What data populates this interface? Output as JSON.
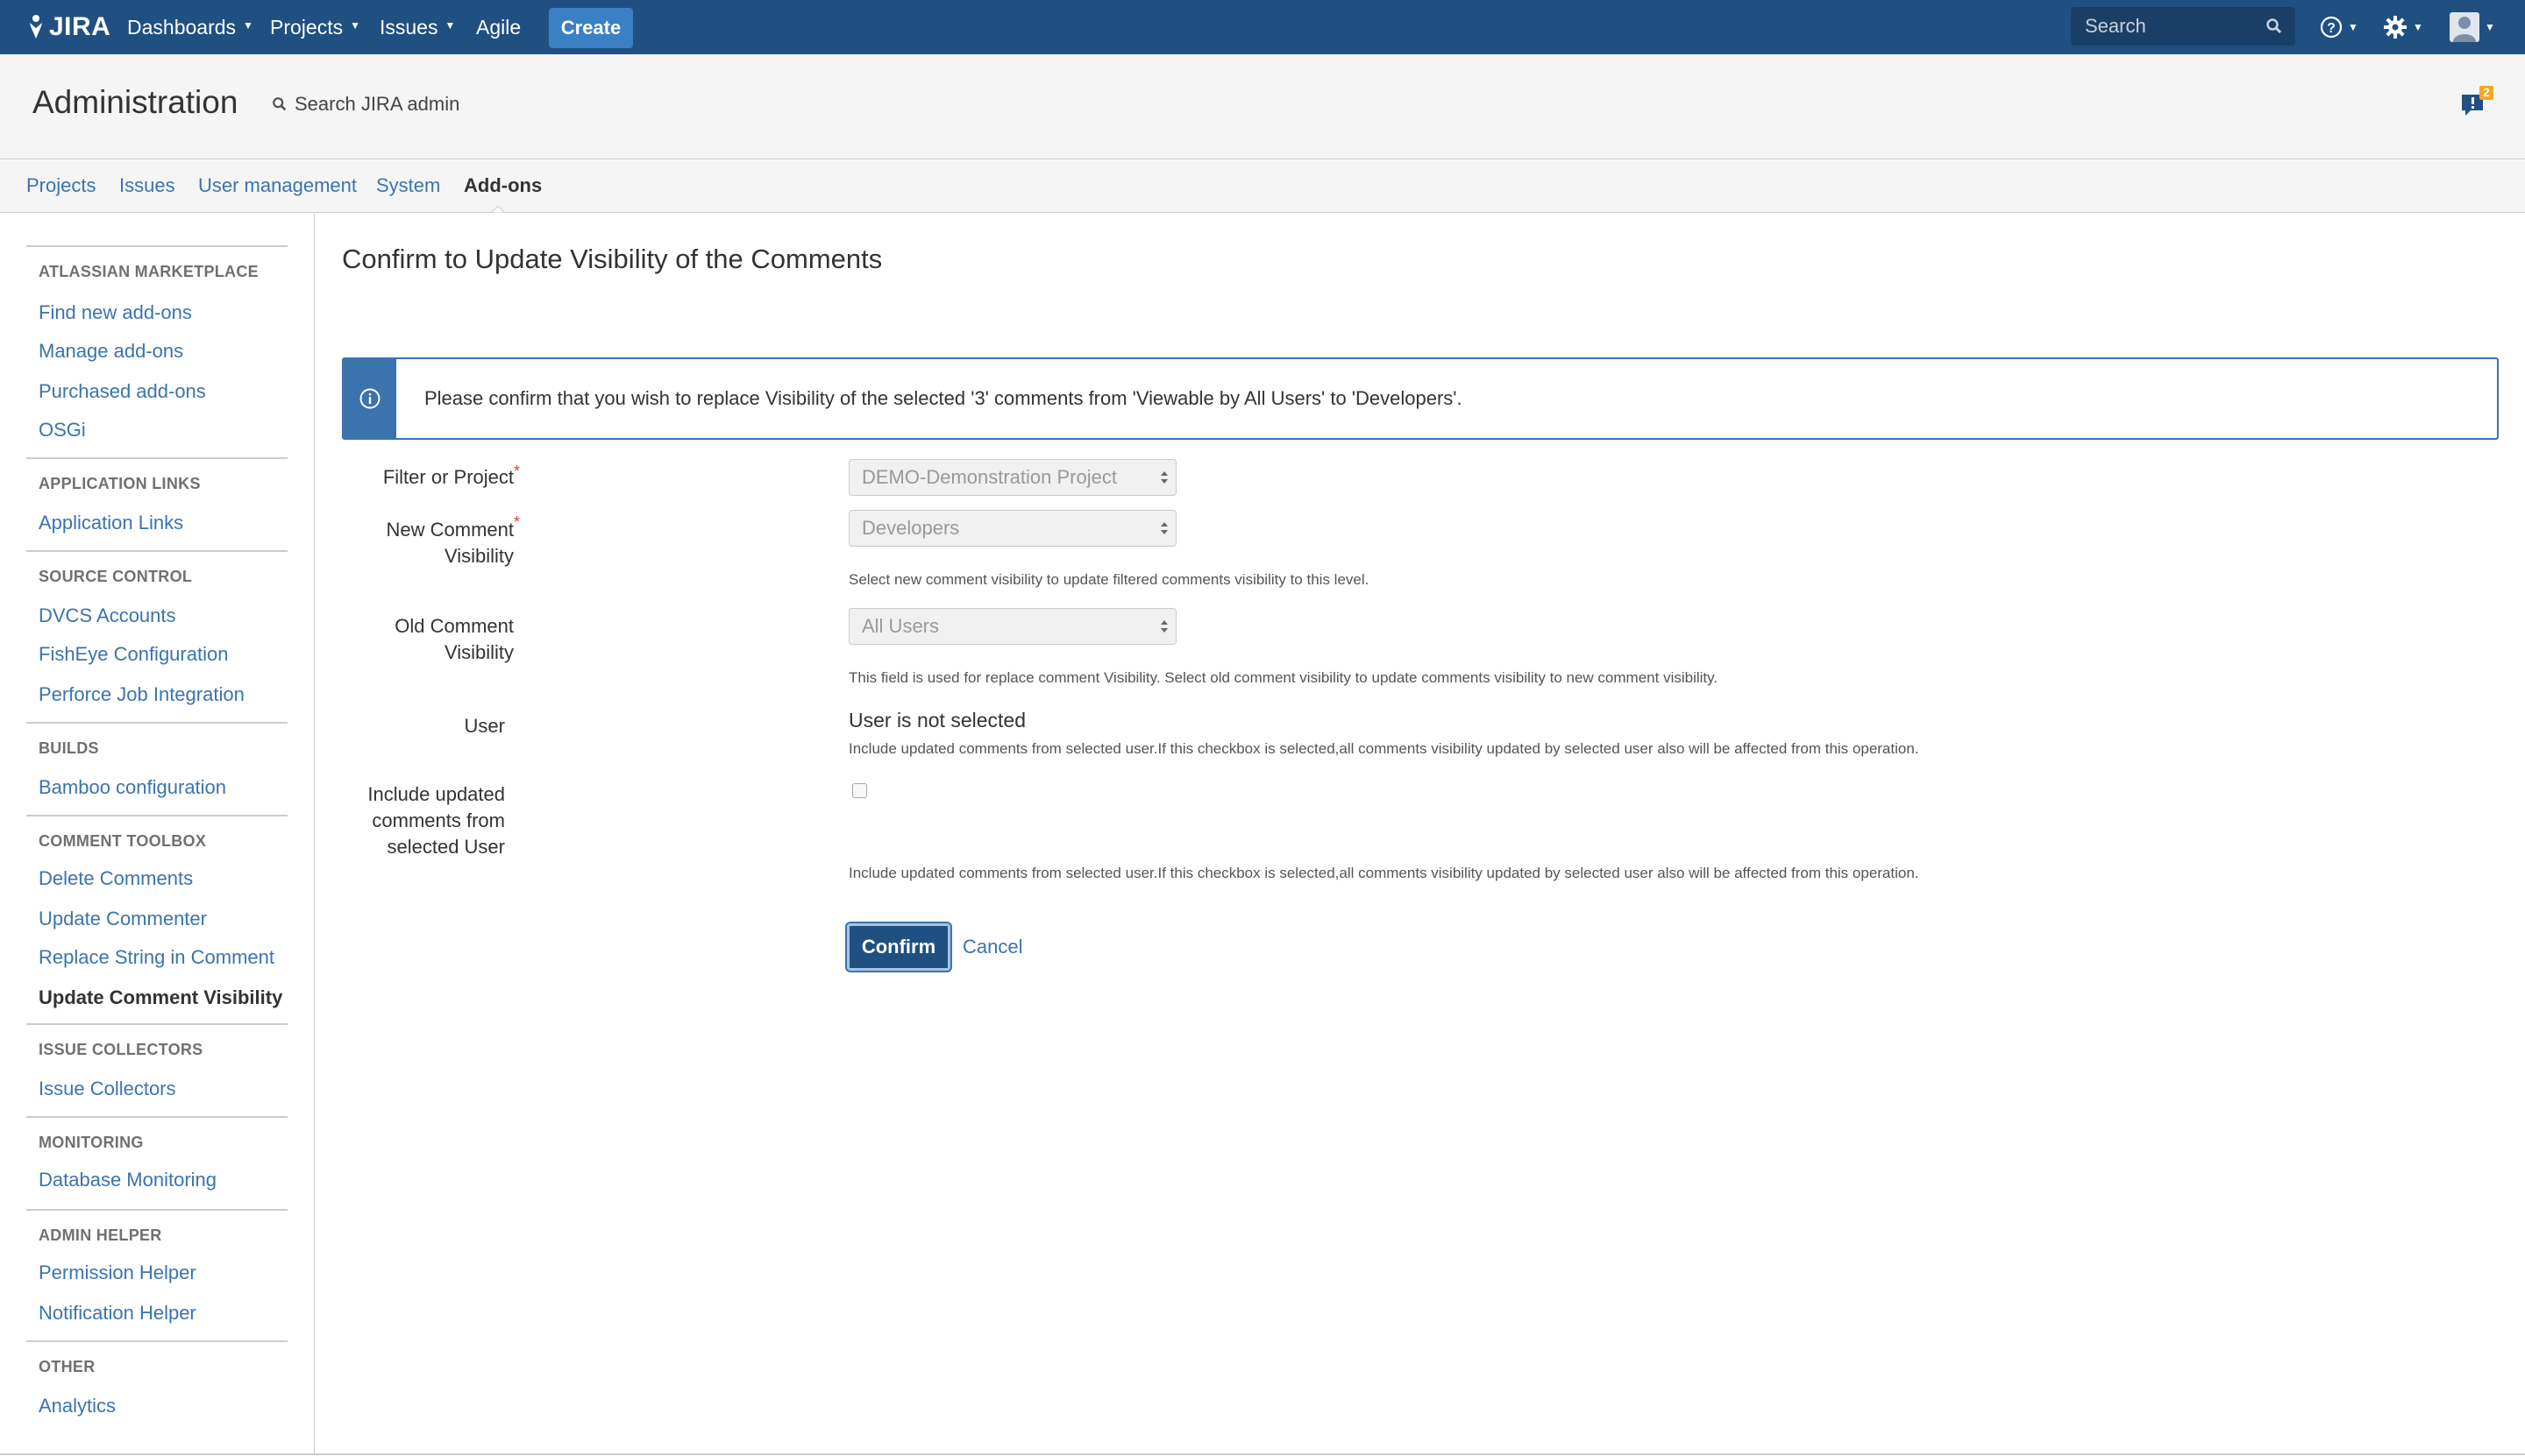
{
  "topbar": {
    "logo_text": "JIRA",
    "nav": [
      {
        "label": "Dashboards",
        "has_caret": true
      },
      {
        "label": "Projects",
        "has_caret": true
      },
      {
        "label": "Issues",
        "has_caret": true
      },
      {
        "label": "Agile",
        "has_caret": false
      }
    ],
    "create_label": "Create",
    "search_placeholder": "Search",
    "icons": [
      "help-icon",
      "gear-icon",
      "user-avatar-icon"
    ],
    "colors": {
      "bar": "#205081",
      "create": "#3b7fc4"
    }
  },
  "admin": {
    "title": "Administration",
    "search_label": "Search JIRA admin",
    "feedback_count": "2",
    "tabs": [
      {
        "label": "Projects",
        "active": false
      },
      {
        "label": "Issues",
        "active": false
      },
      {
        "label": "User management",
        "active": false
      },
      {
        "label": "System",
        "active": false
      },
      {
        "label": "Add-ons",
        "active": true
      }
    ]
  },
  "sidebar": {
    "sections": [
      {
        "heading": "ATLASSIAN MARKETPLACE",
        "items": [
          "Find new add-ons",
          "Manage add-ons",
          "Purchased add-ons",
          "OSGi"
        ]
      },
      {
        "heading": "APPLICATION LINKS",
        "items": [
          "Application Links"
        ]
      },
      {
        "heading": "SOURCE CONTROL",
        "items": [
          "DVCS Accounts",
          "FishEye Configuration",
          "Perforce Job Integration"
        ]
      },
      {
        "heading": "BUILDS",
        "items": [
          "Bamboo configuration"
        ]
      },
      {
        "heading": "COMMENT TOOLBOX",
        "items": [
          "Delete Comments",
          "Update Commenter",
          "Replace String in Comment",
          "Update Comment Visibility"
        ]
      },
      {
        "heading": "ISSUE COLLECTORS",
        "items": [
          "Issue Collectors"
        ]
      },
      {
        "heading": "MONITORING",
        "items": [
          "Database Monitoring"
        ]
      },
      {
        "heading": "ADMIN HELPER",
        "items": [
          "Permission Helper",
          "Notification Helper"
        ]
      },
      {
        "heading": "OTHER",
        "items": [
          "Analytics"
        ]
      }
    ],
    "current_item": "Update Comment Visibility"
  },
  "main": {
    "title": "Confirm to Update Visibility of the Comments",
    "info_message": "Please confirm that you wish to replace Visibility of the selected '3' comments from 'Viewable by All Users' to 'Developers'.",
    "form": {
      "filter_label": "Filter or Project",
      "filter_value": "DEMO-Demonstration Project",
      "new_vis_label_1": "New Comment",
      "new_vis_label_2": "Visibility",
      "new_vis_value": "Developers",
      "new_vis_desc": "Select new comment visibility to update filtered comments visibility to this level.",
      "old_vis_label_1": "Old Comment",
      "old_vis_label_2": "Visibility",
      "old_vis_value": "All Users",
      "old_vis_desc": "This field is used for replace comment Visibility. Select old comment visibility to update comments visibility to new comment visibility.",
      "user_label": "User",
      "user_value": "User is not selected",
      "user_desc": "Include updated comments from selected user.If this checkbox is selected,all comments visibility updated by selected user also will be affected from this operation.",
      "include_label_1": "Include updated",
      "include_label_2": "comments from",
      "include_label_3": "selected User",
      "include_checked": false,
      "include_desc": "Include updated comments from selected user.If this checkbox is selected,all comments visibility updated by selected user also will be affected from this operation.",
      "required_mark": "*"
    },
    "confirm_label": "Confirm",
    "cancel_label": "Cancel"
  }
}
